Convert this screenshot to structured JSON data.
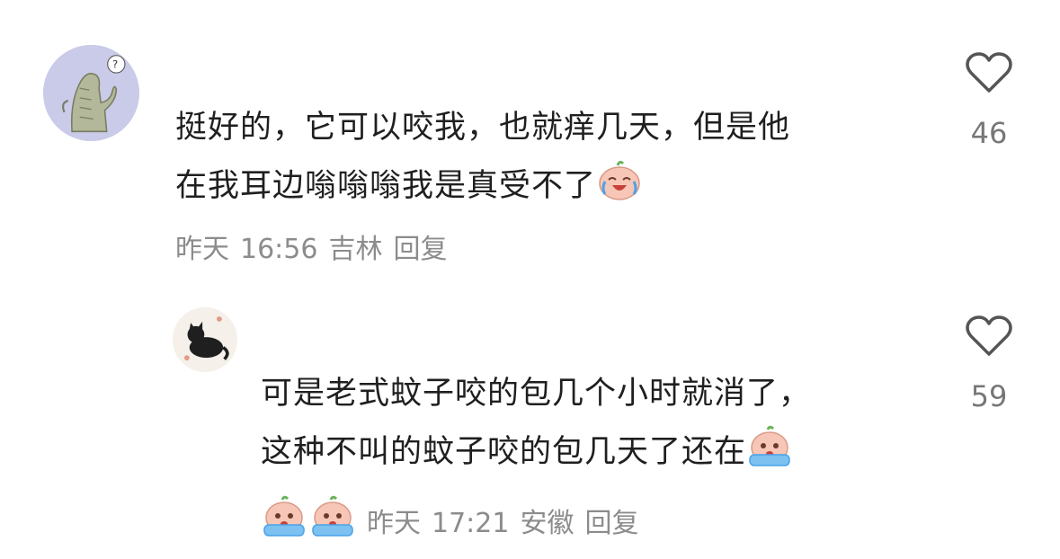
{
  "comments": [
    {
      "avatar": "kaiju-avatar",
      "line1": "挺好的，它可以咬我，也就痒几天，但是他",
      "line2": "在我耳边嗡嗡嗡我是真受不了",
      "date": "昨天",
      "time": "16:56",
      "location": "吉林",
      "reply": "回复",
      "likes": "46"
    },
    {
      "avatar": "black-cat-avatar",
      "line1": "可是老式蚊子咬的包几个小时就消了，",
      "line2": "这种不叫的蚊子咬的包几天了还在",
      "date": "昨天",
      "time": "17:21",
      "location": "安徽",
      "reply": "回复",
      "likes": "59"
    }
  ],
  "icons": {
    "like": "heart-outline-icon",
    "emoji_laugh_cry": "peach-laugh-cry-emoji",
    "emoji_crying": "peach-crying-emoji"
  },
  "colors": {
    "text": "#1f1f1f",
    "meta": "#8c8c8c",
    "heart_stroke": "#555555"
  }
}
